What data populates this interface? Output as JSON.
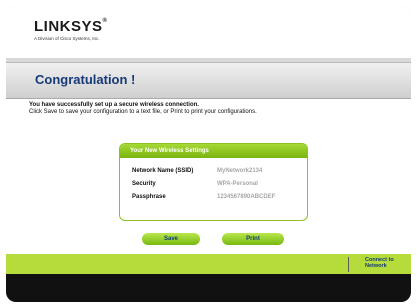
{
  "brand": {
    "name": "LINKSYS",
    "registered_mark": "®",
    "tagline": "A Division of Cisco Systems, Inc."
  },
  "page": {
    "title": "Congratulation !"
  },
  "message": {
    "line1": "You have successfully set up a secure wireless connection.",
    "line2": "Click Save to save your configuration to a text file, or Print to print your configurations."
  },
  "settings": {
    "heading": "Your New Wireless Settings",
    "rows": [
      {
        "label": "Network Name (SSID)",
        "value": "MyNetwork2134"
      },
      {
        "label": "Security",
        "value": "WPA-Personal"
      },
      {
        "label": "Passphrase",
        "value": "1234567890ABCDEF"
      }
    ]
  },
  "actions": {
    "save_label": "Save",
    "print_label": "Print"
  },
  "footer": {
    "connect_line1": "Connect to",
    "connect_line2": "Network"
  },
  "colors": {
    "accent_green": "#8ec21f",
    "title_blue": "#163a78",
    "value_gray": "#a7a7a7",
    "bottom_bar": "#111111"
  }
}
